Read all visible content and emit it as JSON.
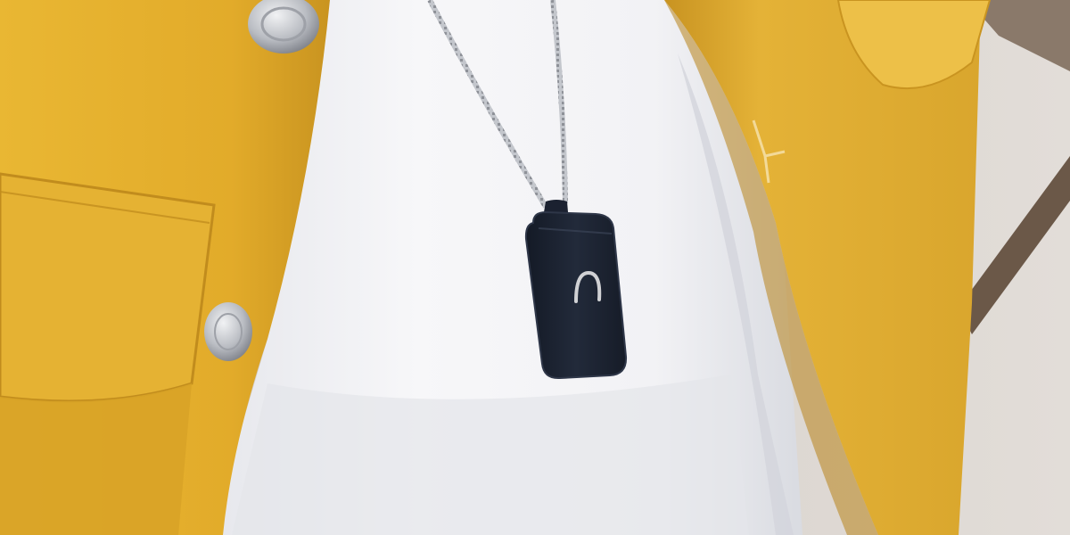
{
  "scene": {
    "subject": "pendant-on-chain",
    "colors": {
      "jacket": "#e2ae2d",
      "jacket_shadow": "#b9851a",
      "jacket_highlight": "#f0c64e",
      "shirt": "#f4f4f6",
      "shirt_shadow": "#dcdde2",
      "background": "#d7d1cc",
      "railing": "#6b5848",
      "pendant": "#1c2230",
      "pendant_edge": "#2e3648",
      "chain": "#b9bcc2",
      "button_metal": "#c9cbd0",
      "logo_mark": "#c8c9cc"
    }
  }
}
